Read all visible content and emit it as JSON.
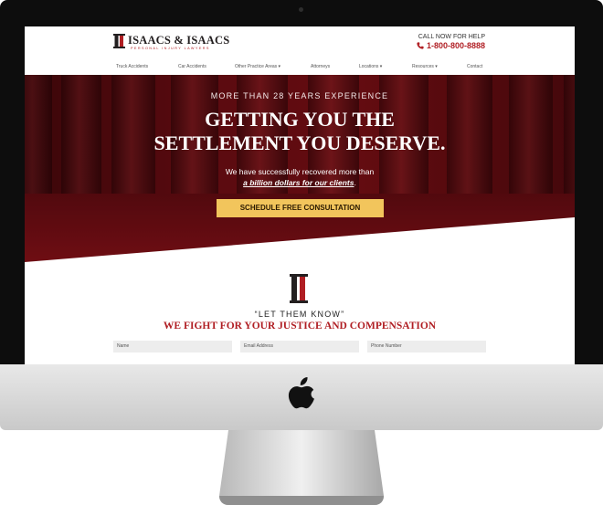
{
  "brand": {
    "name": "ISAACS & ISAACS",
    "tagline": "PERSONAL INJURY LAWYERS",
    "accent": "#b01e23",
    "icon": "pillar-logo-icon"
  },
  "header": {
    "call_label": "CALL NOW FOR HELP",
    "phone": "1-800-800-8888",
    "phone_icon": "phone-icon"
  },
  "nav": {
    "items": [
      {
        "label": "Truck Accidents"
      },
      {
        "label": "Car Accidents"
      },
      {
        "label": "Other Practice Areas ▾"
      },
      {
        "label": "Attorneys"
      },
      {
        "label": "Locations ▾"
      },
      {
        "label": "Resources ▾"
      },
      {
        "label": "Contact"
      }
    ]
  },
  "hero": {
    "kicker": "MORE THAN 28 YEARS EXPERIENCE",
    "headline_line1": "GETTING YOU THE",
    "headline_line2": "SETTLEMENT YOU DESERVE.",
    "intro_line1": "We have successfully recovered more than",
    "intro_emphasis": "a billion dollars for our clients",
    "intro_end": ".",
    "cta_label": "SCHEDULE FREE CONSULTATION",
    "cta_color": "#f2c55c"
  },
  "section": {
    "quote": "“LET THEM KNOW”",
    "heading": "WE FIGHT FOR YOUR JUSTICE AND COMPENSATION"
  },
  "form": {
    "name_placeholder": "Name",
    "email_placeholder": "Email Address",
    "phone_placeholder": "Phone Number"
  },
  "device": {
    "logo_icon": "apple-logo-icon"
  }
}
